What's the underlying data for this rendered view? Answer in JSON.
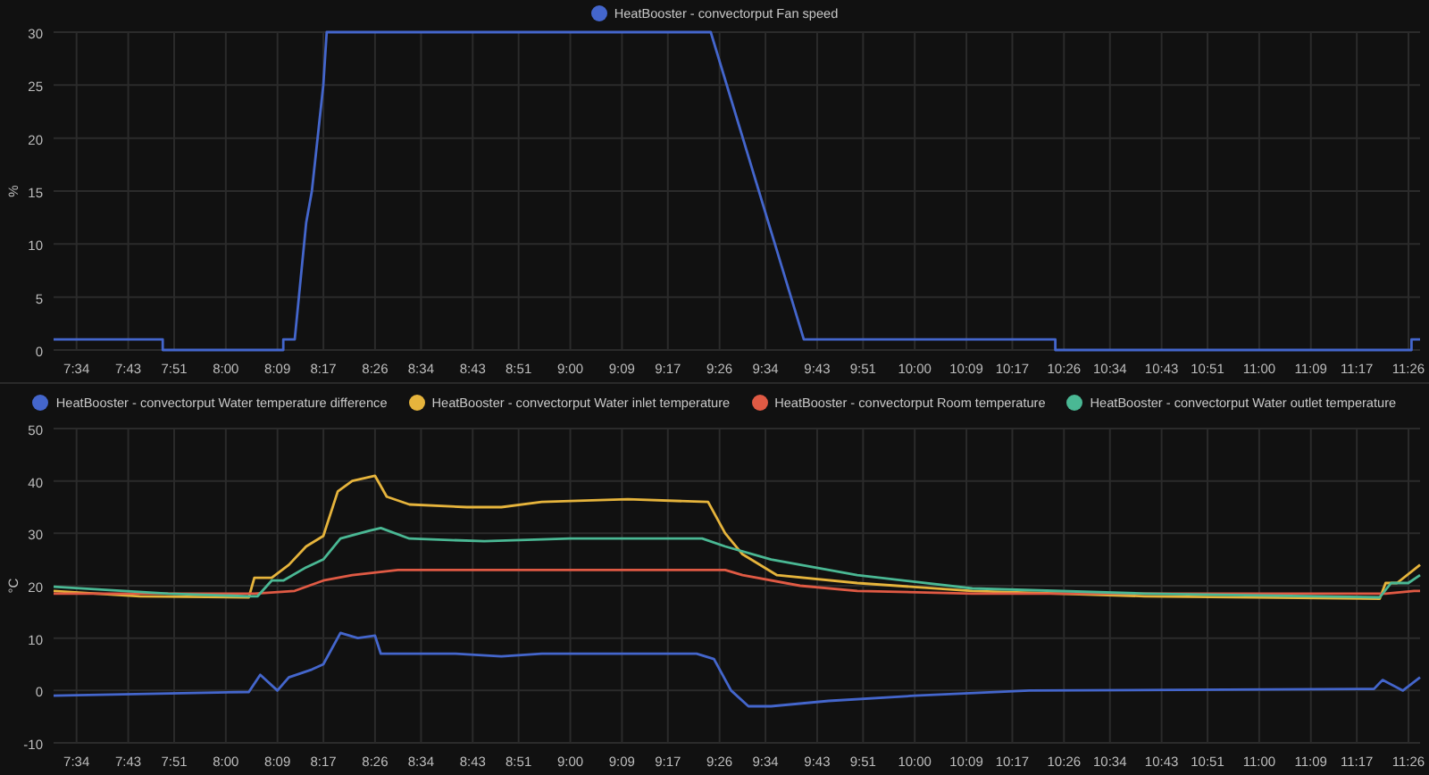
{
  "panels": [
    {
      "chart_data": {
        "type": "line",
        "grid": true,
        "ylabel": "%",
        "xlim": [
          7.5,
          11.467
        ],
        "ylim": [
          0,
          30
        ],
        "yticks": [
          0,
          5,
          10,
          15,
          20,
          25,
          30
        ],
        "xticks": [
          {
            "value": 7.5667,
            "label": "7:34"
          },
          {
            "value": 7.7167,
            "label": "7:43"
          },
          {
            "value": 7.85,
            "label": "7:51"
          },
          {
            "value": 8,
            "label": "8:00"
          },
          {
            "value": 8.15,
            "label": "8:09"
          },
          {
            "value": 8.2833,
            "label": "8:17"
          },
          {
            "value": 8.4333,
            "label": "8:26"
          },
          {
            "value": 8.5667,
            "label": "8:34"
          },
          {
            "value": 8.7167,
            "label": "8:43"
          },
          {
            "value": 8.85,
            "label": "8:51"
          },
          {
            "value": 9,
            "label": "9:00"
          },
          {
            "value": 9.15,
            "label": "9:09"
          },
          {
            "value": 9.2833,
            "label": "9:17"
          },
          {
            "value": 9.4333,
            "label": "9:26"
          },
          {
            "value": 9.5667,
            "label": "9:34"
          },
          {
            "value": 9.7167,
            "label": "9:43"
          },
          {
            "value": 9.85,
            "label": "9:51"
          },
          {
            "value": 10,
            "label": "10:00"
          },
          {
            "value": 10.15,
            "label": "10:09"
          },
          {
            "value": 10.2833,
            "label": "10:17"
          },
          {
            "value": 10.4333,
            "label": "10:26"
          },
          {
            "value": 10.5667,
            "label": "10:34"
          },
          {
            "value": 10.7167,
            "label": "10:43"
          },
          {
            "value": 10.85,
            "label": "10:51"
          },
          {
            "value": 11,
            "label": "11:00"
          },
          {
            "value": 11.15,
            "label": "11:09"
          },
          {
            "value": 11.2833,
            "label": "11:17"
          },
          {
            "value": 11.4333,
            "label": "11:26"
          }
        ],
        "series": [
          {
            "name": "HeatBooster - convectorput Fan speed",
            "color": "#4466cc",
            "x": [
              7.5,
              7.817,
              7.817,
              8.167,
              8.167,
              8.2,
              8.233,
              8.25,
              8.283,
              8.293,
              9.408,
              9.678,
              10.408,
              10.408,
              11.442,
              11.442,
              11.467
            ],
            "values": [
              1,
              1,
              0,
              0,
              1,
              1,
              12,
              15,
              25,
              30,
              30,
              1,
              1,
              0,
              0,
              1,
              1
            ]
          }
        ]
      }
    },
    {
      "chart_data": {
        "type": "line",
        "grid": true,
        "ylabel": "°C",
        "xlim": [
          7.5,
          11.467
        ],
        "ylim": [
          -10,
          50
        ],
        "yticks": [
          -10,
          0,
          10,
          20,
          30,
          40,
          50
        ],
        "xticks": [
          {
            "value": 7.5667,
            "label": "7:34"
          },
          {
            "value": 7.7167,
            "label": "7:43"
          },
          {
            "value": 7.85,
            "label": "7:51"
          },
          {
            "value": 8,
            "label": "8:00"
          },
          {
            "value": 8.15,
            "label": "8:09"
          },
          {
            "value": 8.2833,
            "label": "8:17"
          },
          {
            "value": 8.4333,
            "label": "8:26"
          },
          {
            "value": 8.5667,
            "label": "8:34"
          },
          {
            "value": 8.7167,
            "label": "8:43"
          },
          {
            "value": 8.85,
            "label": "8:51"
          },
          {
            "value": 9,
            "label": "9:00"
          },
          {
            "value": 9.15,
            "label": "9:09"
          },
          {
            "value": 9.2833,
            "label": "9:17"
          },
          {
            "value": 9.4333,
            "label": "9:26"
          },
          {
            "value": 9.5667,
            "label": "9:34"
          },
          {
            "value": 9.7167,
            "label": "9:43"
          },
          {
            "value": 9.85,
            "label": "9:51"
          },
          {
            "value": 10,
            "label": "10:00"
          },
          {
            "value": 10.15,
            "label": "10:09"
          },
          {
            "value": 10.2833,
            "label": "10:17"
          },
          {
            "value": 10.4333,
            "label": "10:26"
          },
          {
            "value": 10.5667,
            "label": "10:34"
          },
          {
            "value": 10.7167,
            "label": "10:43"
          },
          {
            "value": 10.85,
            "label": "10:51"
          },
          {
            "value": 11,
            "label": "11:00"
          },
          {
            "value": 11.15,
            "label": "11:09"
          },
          {
            "value": 11.2833,
            "label": "11:17"
          },
          {
            "value": 11.4333,
            "label": "11:26"
          }
        ],
        "series": [
          {
            "name": "HeatBooster - convectorput Water temperature difference",
            "color": "#4466cc",
            "x": [
              7.5,
              8.067,
              8.1,
              8.15,
              8.183,
              8.25,
              8.283,
              8.333,
              8.383,
              8.433,
              8.45,
              8.667,
              8.8,
              8.917,
              9.367,
              9.417,
              9.467,
              9.517,
              9.583,
              9.75,
              10,
              10.333,
              11.333,
              11.358,
              11.417,
              11.467
            ],
            "values": [
              -1,
              -0.3,
              3,
              0,
              2.5,
              4,
              5,
              11,
              10,
              10.5,
              7,
              7,
              6.5,
              7,
              7,
              6,
              0,
              -3,
              -3,
              -2,
              -1,
              0,
              0.3,
              2,
              0,
              2.5
            ]
          },
          {
            "name": "HeatBooster - convectorput Water inlet temperature",
            "color": "#e6b43c",
            "x": [
              7.5,
              7.75,
              8.067,
              8.083,
              8.133,
              8.183,
              8.233,
              8.283,
              8.325,
              8.367,
              8.433,
              8.467,
              8.533,
              8.7,
              8.8,
              8.917,
              9.167,
              9.4,
              9.45,
              9.5,
              9.6,
              9.833,
              10.167,
              10.667,
              11.35,
              11.367,
              11.4,
              11.467
            ],
            "values": [
              19,
              18,
              17.8,
              21.5,
              21.5,
              24,
              27.5,
              29.5,
              38,
              40,
              41,
              37,
              35.5,
              35,
              35,
              36,
              36.5,
              36,
              30,
              26,
              22,
              20.5,
              19,
              18,
              17.5,
              20.5,
              20.5,
              24
            ]
          },
          {
            "name": "HeatBooster - convectorput Room temperature",
            "color": "#e05a44",
            "x": [
              7.5,
              8.083,
              8.2,
              8.283,
              8.367,
              8.5,
              9.45,
              9.5,
              9.667,
              9.833,
              10.167,
              11.367,
              11.45,
              11.467
            ],
            "values": [
              18.5,
              18.5,
              19,
              21,
              22,
              23,
              23,
              22,
              20,
              19,
              18.5,
              18.5,
              19,
              19
            ]
          },
          {
            "name": "HeatBooster - convectorput Water outlet temperature",
            "color": "#4ab894",
            "x": [
              7.5,
              7.833,
              8.067,
              8.092,
              8.133,
              8.167,
              8.233,
              8.283,
              8.333,
              8.417,
              8.45,
              8.533,
              8.75,
              9,
              9.383,
              9.45,
              9.583,
              9.833,
              10.167,
              10.667,
              11.35,
              11.383,
              11.433,
              11.467
            ],
            "values": [
              19.8,
              18.5,
              18,
              18,
              21,
              21,
              23.5,
              25,
              29,
              30.5,
              31,
              29,
              28.5,
              29,
              29,
              27.5,
              25,
              22,
              19.5,
              18.5,
              17.8,
              20.5,
              20.5,
              22
            ]
          }
        ]
      }
    }
  ]
}
